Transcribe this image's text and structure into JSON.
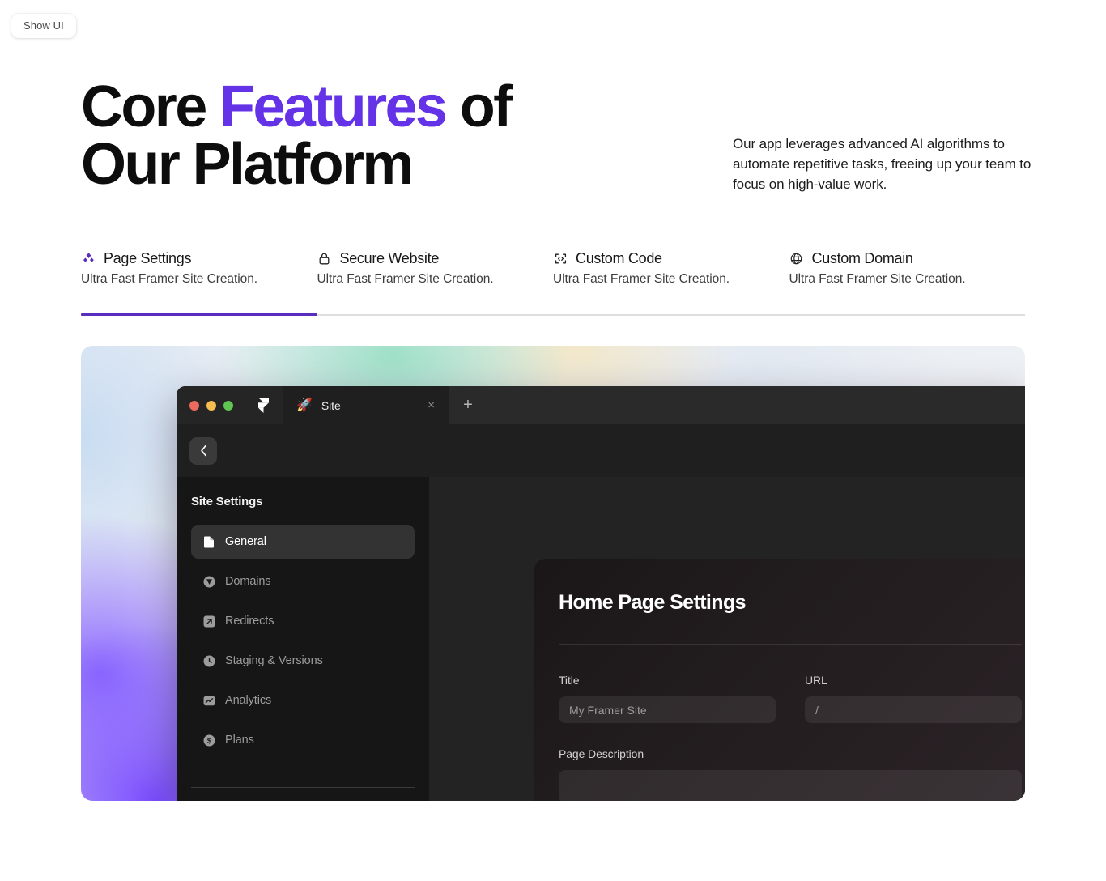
{
  "overlay": {
    "show_ui_label": "Show UI"
  },
  "hero": {
    "title_part1": "Core ",
    "title_accent": "Features",
    "title_part2": " of",
    "title_line2": "Our Platform",
    "subtitle": "Our app leverages advanced AI algorithms to automate repetitive tasks, freeing up your team to focus on high-value work.",
    "accent_color": "#6433E8"
  },
  "feature_tabs": [
    {
      "icon": "sparkle-diamond-icon",
      "label": "Page Settings",
      "desc": "Ultra Fast Framer Site Creation.",
      "active": true
    },
    {
      "icon": "lock-icon",
      "label": "Secure Website",
      "desc": "Ultra Fast Framer Site Creation.",
      "active": false
    },
    {
      "icon": "code-brackets-icon",
      "label": "Custom Code",
      "desc": "Ultra Fast Framer Site Creation.",
      "active": false
    },
    {
      "icon": "globe-icon",
      "label": "Custom Domain",
      "desc": "Ultra Fast Framer Site Creation.",
      "active": false
    }
  ],
  "showcase": {
    "browser": {
      "traffic_lights": [
        "red",
        "yellow",
        "green"
      ],
      "app_logo": "framer-logo-icon",
      "tab": {
        "emoji": "🚀",
        "title": "Site",
        "close_label": "×"
      },
      "new_tab_label": "+",
      "back_label": "‹"
    },
    "sidebar": {
      "title": "Site Settings",
      "items": [
        {
          "icon": "page-icon",
          "label": "General",
          "active": true
        },
        {
          "icon": "domains-icon",
          "label": "Domains",
          "active": false
        },
        {
          "icon": "redirects-icon",
          "label": "Redirects",
          "active": false
        },
        {
          "icon": "clock-icon",
          "label": "Staging & Versions",
          "active": false
        },
        {
          "icon": "analytics-icon",
          "label": "Analytics",
          "active": false
        },
        {
          "icon": "dollar-icon",
          "label": "Plans",
          "active": false
        }
      ]
    },
    "panel": {
      "title": "Home Page Settings",
      "fields": [
        {
          "label": "Title",
          "value": "My Framer Site"
        },
        {
          "label": "URL",
          "value": "/"
        }
      ],
      "description_label": "Page Description"
    }
  }
}
